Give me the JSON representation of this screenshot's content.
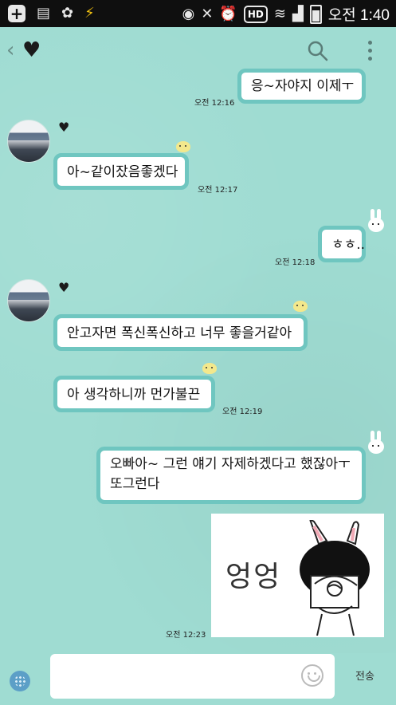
{
  "status_bar": {
    "time": "오전 1:40",
    "hd_label": "HD",
    "icons": [
      "plus-icon",
      "sim-card-icon",
      "flower-icon",
      "bolt-icon",
      "eye-icon",
      "mute-icon",
      "alarm-icon",
      "hd-icon",
      "wifi-icon",
      "signal-icon",
      "battery-icon"
    ]
  },
  "header": {
    "back_glyph": "‹",
    "title_glyph": "♥"
  },
  "messages": [
    {
      "side": "right",
      "text": "응~자야지 이제ㅜ",
      "time": "오전 12:16"
    },
    {
      "side": "left",
      "text": "아~같이잤음좋겠다",
      "time": "오전 12:17"
    },
    {
      "side": "right",
      "text": "ㅎㅎ..",
      "time": "오전 12:18"
    },
    {
      "side": "left",
      "text": "안고자면 폭신폭신하고 너무 좋을거같아",
      "time": ""
    },
    {
      "side": "left",
      "text": "아 생각하니까 먼가불끈",
      "time": "오전 12:19"
    },
    {
      "side": "right",
      "text": "오빠아~ 그런 얘기 자제하겠다고 했잖아ㅜ또그런다",
      "time": ""
    },
    {
      "side": "right",
      "sticker_text": "엉엉",
      "time": "오전 12:23"
    }
  ],
  "sender": {
    "name_glyph": "♥"
  },
  "input": {
    "placeholder": "",
    "send_label": "전송"
  },
  "colors": {
    "background": "#9fdcd2",
    "bubble_border": "#6fc6c0",
    "status_bar": "#0f0f0f"
  }
}
